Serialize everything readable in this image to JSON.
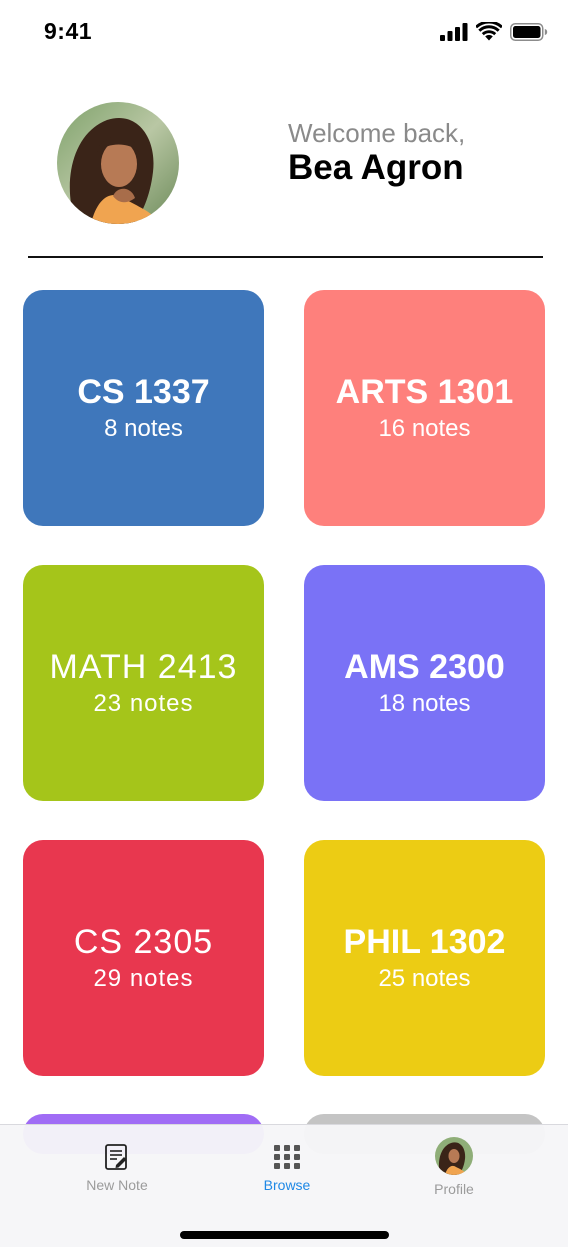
{
  "status_bar": {
    "time": "9:41"
  },
  "header": {
    "welcome": "Welcome back,",
    "user_name": "Bea Agron"
  },
  "courses": [
    {
      "title": "CS 1337",
      "notes": "8 notes",
      "color": "#3F77BB"
    },
    {
      "title": "ARTS 1301",
      "notes": "16 notes",
      "color": "#FE807C"
    },
    {
      "title": "MATH 2413",
      "notes": "23 notes",
      "color": "#A5C51A"
    },
    {
      "title": "AMS 2300",
      "notes": "18 notes",
      "color": "#7A72F6"
    },
    {
      "title": "CS 2305",
      "notes": "29 notes",
      "color": "#E8374F"
    },
    {
      "title": "PHIL 1302",
      "notes": "25 notes",
      "color": "#ECCC14"
    }
  ],
  "partial_cards": [
    {
      "color": "#A06CF5"
    },
    {
      "color": "#C4C4C4"
    }
  ],
  "tab_bar": {
    "new_note": "New Note",
    "browse": "Browse",
    "profile": "Profile",
    "active_color": "#1E88E5",
    "inactive_color": "#9B9B9B"
  }
}
